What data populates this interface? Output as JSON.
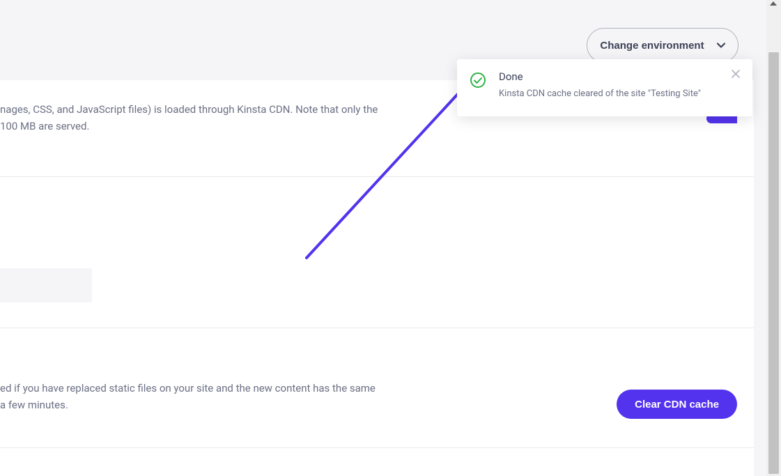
{
  "header": {
    "change_env_label": "Change environment"
  },
  "section1": {
    "line1": "nages, CSS, and JavaScript files) is loaded through Kinsta CDN. Note that only the",
    "line2": " 100 MB are served."
  },
  "section3": {
    "line1": "ed if you have replaced static files on your site and the new content has the same",
    "line2": "a few minutes.",
    "button_label": "Clear CDN cache"
  },
  "toast": {
    "title": "Done",
    "message": "Kinsta CDN cache cleared of the site \"Testing Site\""
  },
  "colors": {
    "accent": "#5333ed",
    "success": "#2fb344"
  }
}
